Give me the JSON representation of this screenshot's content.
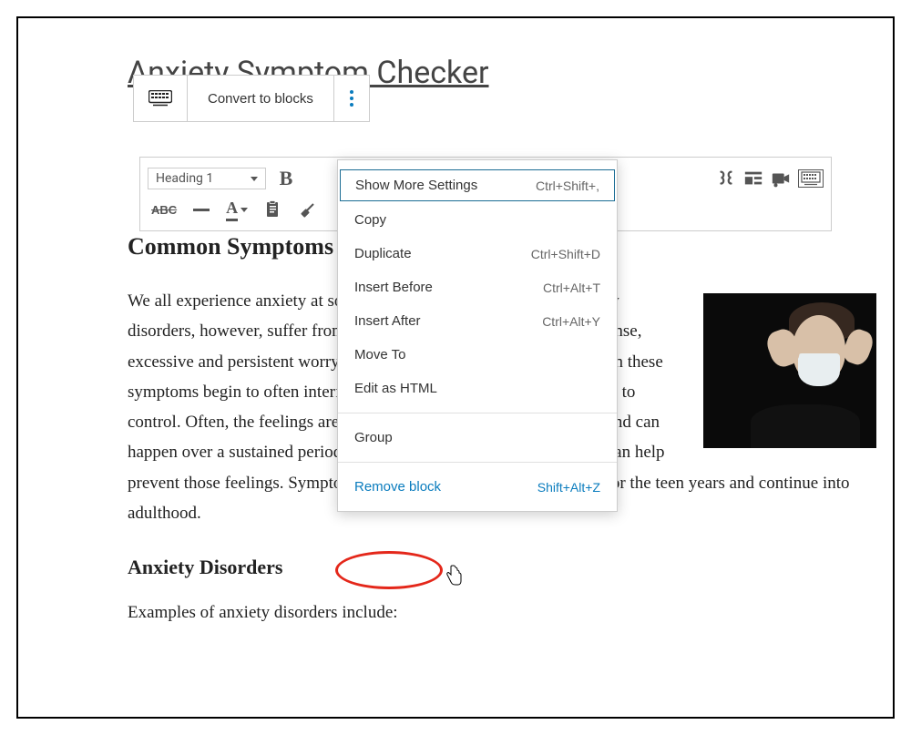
{
  "page_title": "Anxiety Symptom Checker",
  "block_toolbar": {
    "convert_label": "Convert to blocks"
  },
  "editor_toolbar": {
    "heading_selected": "Heading 1",
    "bold": "B",
    "abc": "ABC",
    "text_A": "A"
  },
  "document": {
    "h2": "Common Symptoms",
    "p1": "We all experience anxiety at some time or another.  People with anxiety disorders, however,  suffer from repeated and chronic attacks from intense, excessive and persistent worry and fear about everyday situations when these symptoms begin to often interfere with daily activities and are difficult to control. Often, the feelings are out of proportion to the actual danger and can happen over a sustained period. Avoiding certain places or situations can help prevent those feelings. Symptoms may have started during childhood or the teen years and continue into adulthood.",
    "h3": "Anxiety Disorders",
    "p2": "Examples of anxiety disorders include:"
  },
  "menu": {
    "show_more": "Show More Settings",
    "show_more_kbd": "Ctrl+Shift+,",
    "copy": "Copy",
    "duplicate": "Duplicate",
    "duplicate_kbd": "Ctrl+Shift+D",
    "insert_before": "Insert Before",
    "insert_before_kbd": "Ctrl+Alt+T",
    "insert_after": "Insert After",
    "insert_after_kbd": "Ctrl+Alt+Y",
    "move_to": "Move To",
    "edit_html": "Edit as HTML",
    "group": "Group",
    "remove": "Remove block",
    "remove_kbd": "Shift+Alt+Z"
  }
}
